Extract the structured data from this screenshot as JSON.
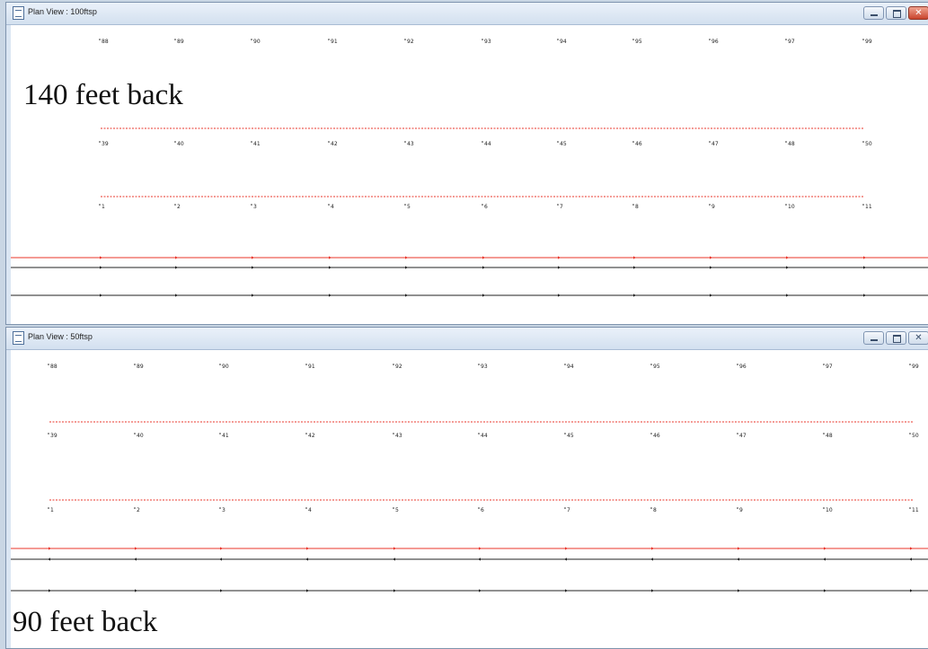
{
  "windows": [
    {
      "title": "Plan View : 100ftsp",
      "caption": "140 feet back",
      "rows": [
        [
          "88",
          "89",
          "90",
          "91",
          "92",
          "93",
          "94",
          "95",
          "96",
          "97",
          "99"
        ],
        [
          "39",
          "40",
          "41",
          "42",
          "43",
          "44",
          "45",
          "46",
          "47",
          "48",
          "50"
        ],
        [
          "1",
          "2",
          "3",
          "4",
          "5",
          "6",
          "7",
          "8",
          "9",
          "10",
          "11"
        ]
      ],
      "controls": {
        "minimize": "minimize",
        "maximize": "maximize",
        "close": "close"
      }
    },
    {
      "title": "Plan View : 50ftsp",
      "caption": "90 feet back",
      "rows": [
        [
          "88",
          "89",
          "90",
          "91",
          "92",
          "93",
          "94",
          "95",
          "96",
          "97",
          "99"
        ],
        [
          "39",
          "40",
          "41",
          "42",
          "43",
          "44",
          "45",
          "46",
          "47",
          "48",
          "50"
        ],
        [
          "1",
          "2",
          "3",
          "4",
          "5",
          "6",
          "7",
          "8",
          "9",
          "10",
          "11"
        ]
      ],
      "controls": {
        "minimize": "minimize",
        "maximize": "maximize",
        "close": "close"
      }
    }
  ],
  "colors": {
    "route_red": "#e8342a",
    "route_black": "#222222"
  }
}
